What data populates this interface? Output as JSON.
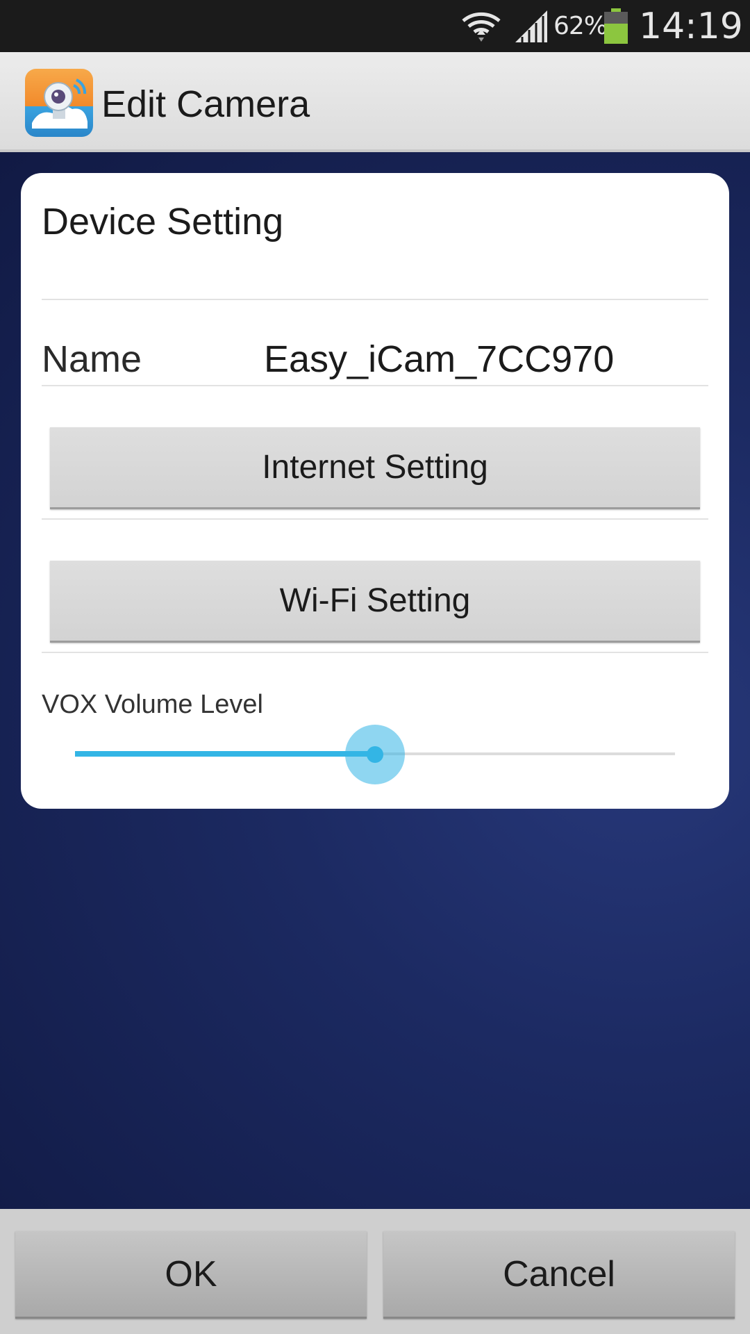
{
  "status_bar": {
    "battery_percent": "62%",
    "time": "14:19",
    "battery_level": 0.62,
    "icons": [
      "wifi-icon",
      "signal-icon",
      "battery-icon"
    ]
  },
  "action_bar": {
    "app_icon": "camera-app-icon",
    "title": "Edit Camera"
  },
  "card": {
    "title": "Device Setting",
    "name_label": "Name",
    "name_value": "Easy_iCam_7CC970",
    "internet_setting_label": "Internet Setting",
    "wifi_setting_label": "Wi-Fi Setting",
    "vox_label": "VOX Volume Level",
    "vox_level": 0.5
  },
  "bottom": {
    "ok_label": "OK",
    "cancel_label": "Cancel"
  },
  "colors": {
    "accent": "#33b5e5",
    "status_bar_bg": "#1b1b1b",
    "battery_green": "#8cc63f",
    "background_blue": "#1c2a62"
  }
}
